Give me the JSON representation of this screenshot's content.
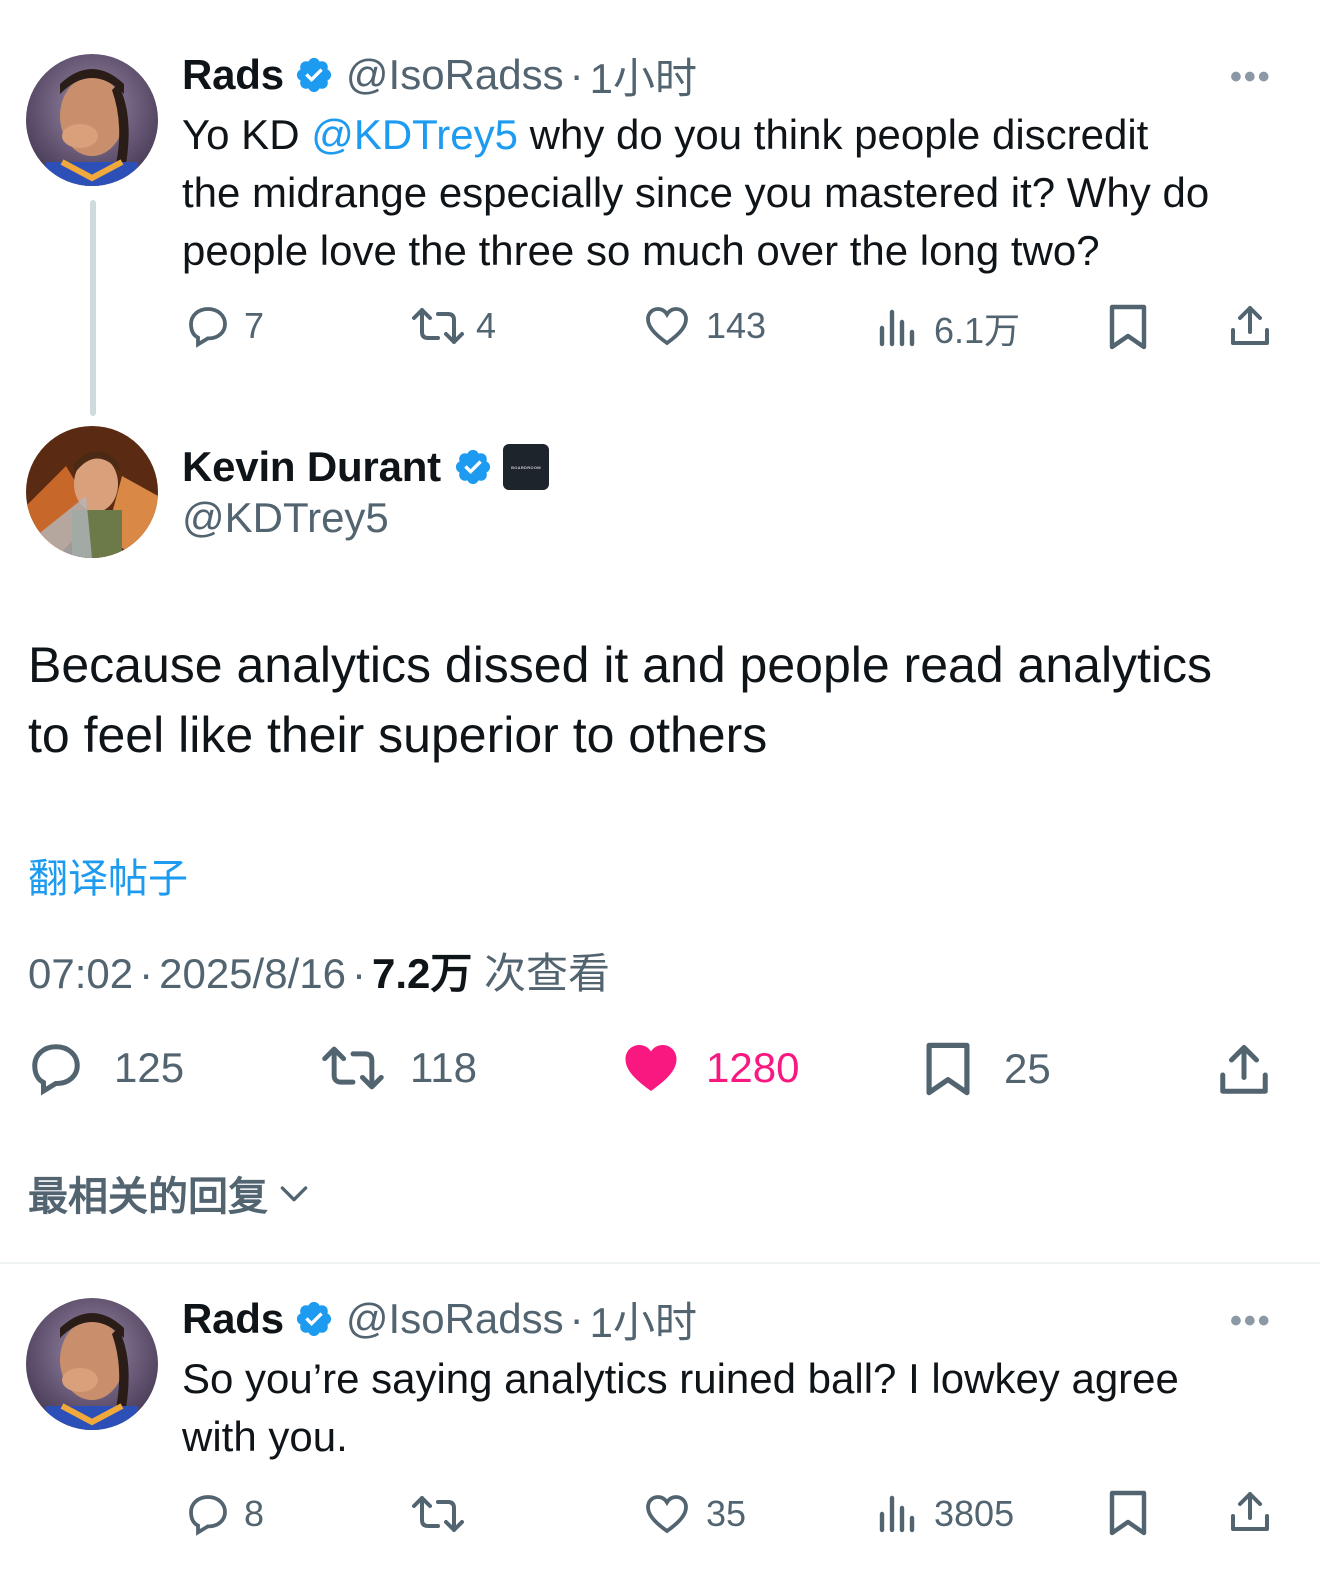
{
  "tweet1": {
    "author_name": "Rads",
    "handle": "@IsoRadss",
    "sep": "·",
    "time": "1小时",
    "text_pre": "Yo KD ",
    "mention": "@KDTrey5",
    "text_line1_post": " why do you think people discredit",
    "text_line2": "the midrange especially since you mastered it? Why do",
    "text_line3": "people love the three so much over the long two?",
    "replies": "7",
    "retweets": "4",
    "likes": "143",
    "views": "6.1万",
    "more": "•••"
  },
  "tweet2": {
    "author_name": "Kevin Durant",
    "handle": "@KDTrey5",
    "affiliate_badge": "BOARDROOM",
    "text_line1": "Because analytics dissed it and people read analytics",
    "text_line2": "to feel like their superior to others",
    "translate_link": "翻译帖子",
    "time": "07:02",
    "sep": "·",
    "date": "2025/8/16",
    "views_count": "7.2万",
    "views_label": " 次查看",
    "replies": "125",
    "retweets": "118",
    "likes": "1280",
    "bookmarks": "25"
  },
  "replies_sort": {
    "label": "最相关的回复"
  },
  "tweet3": {
    "author_name": "Rads",
    "handle": "@IsoRadss",
    "sep": "·",
    "time": "1小时",
    "text_line1": "So you’re saying analytics ruined ball? I lowkey agree",
    "text_line2": "with you.",
    "replies": "8",
    "retweets": "",
    "likes": "35",
    "views": "3805",
    "more": "•••"
  },
  "colors": {
    "accent": "#1d9bf0",
    "like_active": "#f91880",
    "secondary_text": "#536471"
  },
  "icons": [
    "verified-icon",
    "reply-icon",
    "retweet-icon",
    "like-icon",
    "views-icon",
    "bookmark-icon",
    "share-icon",
    "more-icon",
    "chevron-down-icon"
  ]
}
